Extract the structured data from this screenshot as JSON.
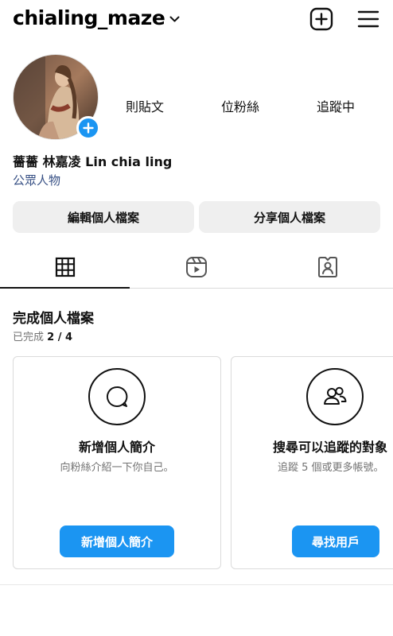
{
  "header": {
    "username": "chialing_maze",
    "icons": {
      "dropdown": "chevron-down-icon",
      "create": "plus-square-icon",
      "menu": "hamburger-menu-icon"
    }
  },
  "profile": {
    "stats": {
      "posts_label": "則貼文",
      "followers_label": "位粉絲",
      "following_label": "追蹤中"
    },
    "display_name": "薔薔 林嘉凌 Lin chia ling",
    "category": "公眾人物",
    "edit_button": "編輯個人檔案",
    "share_button": "分享個人檔案"
  },
  "tabs": [
    {
      "icon": "grid-icon",
      "active": true
    },
    {
      "icon": "reels-icon",
      "active": false
    },
    {
      "icon": "tagged-icon",
      "active": false
    }
  ],
  "completion": {
    "title": "完成個人檔案",
    "progress_prefix": "已完成",
    "progress_value": "2 / 4",
    "cards": [
      {
        "icon": "speech-bubble-icon",
        "title": "新增個人簡介",
        "subtitle": "向粉絲介紹一下你自己。",
        "button": "新增個人簡介"
      },
      {
        "icon": "people-icon",
        "title": "搜尋可以追蹤的對象",
        "subtitle": "追蹤 5 個或更多帳號。",
        "button": "尋找用戶"
      }
    ]
  },
  "colors": {
    "accent": "#1b95f2",
    "category": "#385185",
    "muted": "#737373",
    "button_bg": "#efefef"
  }
}
